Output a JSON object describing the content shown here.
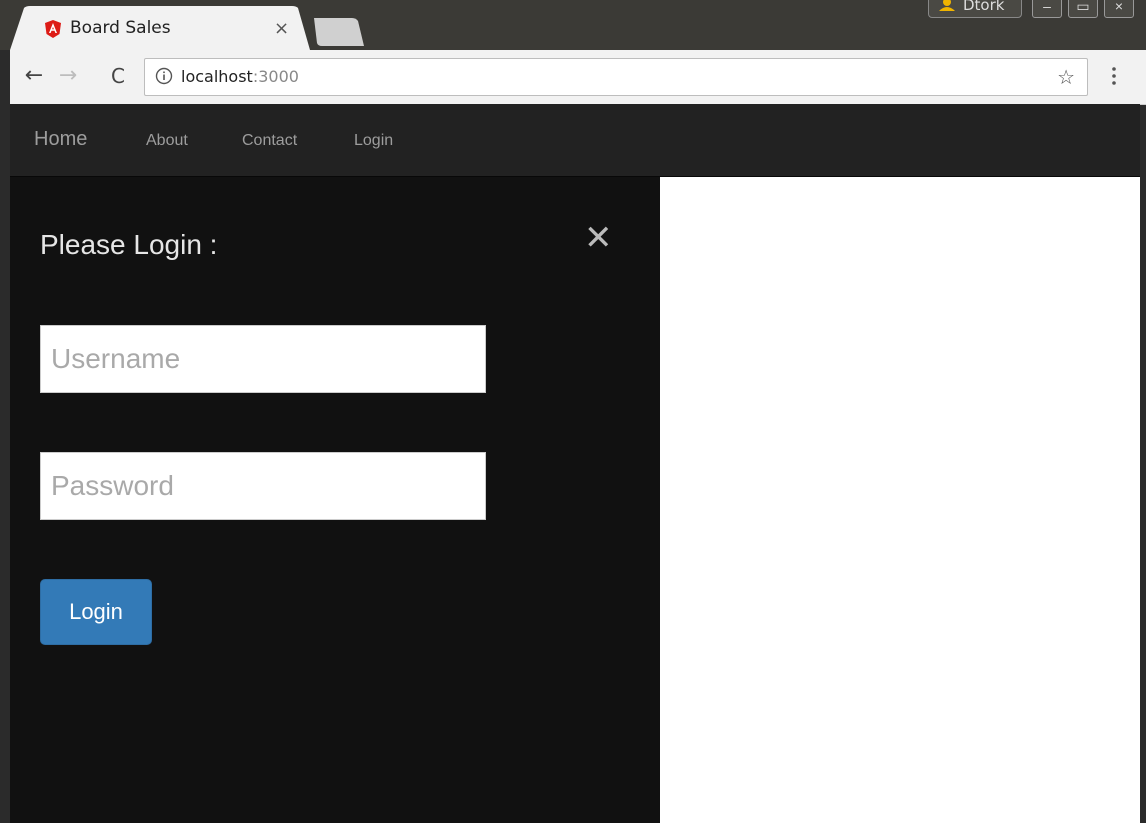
{
  "browser": {
    "tab": {
      "title": "Board Sales",
      "close_glyph": "×",
      "favicon": "angular-icon"
    },
    "profile": {
      "name": "Dtork"
    },
    "window_controls": [
      "–",
      "▭",
      "×"
    ],
    "toolbar": {
      "back_glyph": "←",
      "forward_glyph": "→",
      "reload_glyph": "C",
      "url_host": "localhost",
      "url_port": ":3000",
      "star_glyph": "☆"
    }
  },
  "navbar": {
    "brand": "Home",
    "links": [
      "About",
      "Contact",
      "Login"
    ]
  },
  "login_panel": {
    "heading": "Please Login :",
    "close_glyph": "✕",
    "username_placeholder": "Username",
    "password_placeholder": "Password",
    "submit_label": "Login"
  },
  "colors": {
    "navbar_bg": "#222222",
    "panel_bg": "#111111",
    "primary_button": "#337ab7"
  }
}
